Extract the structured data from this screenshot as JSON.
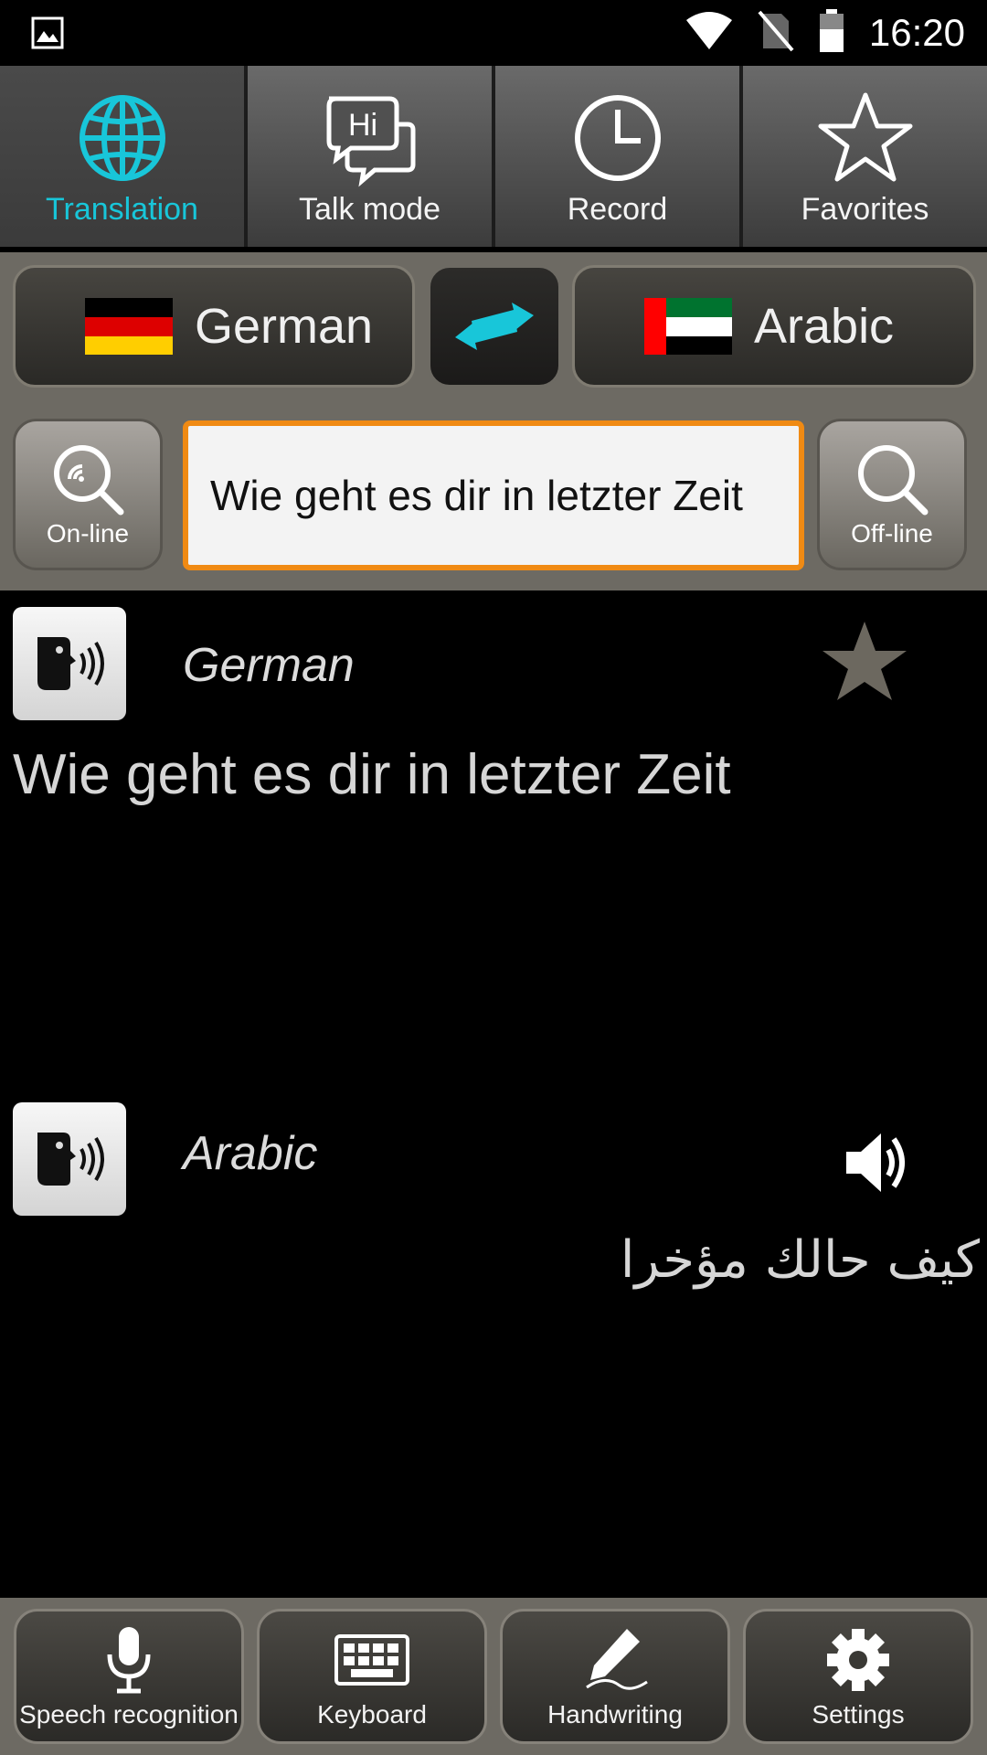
{
  "status": {
    "time": "16:20",
    "icons": [
      "image-icon",
      "wifi-icon",
      "no-sim-icon",
      "battery-icon"
    ]
  },
  "tabs": [
    {
      "label": "Translation",
      "icon": "globe-icon",
      "active": true
    },
    {
      "label": "Talk mode",
      "icon": "chat-bubbles-icon",
      "active": false
    },
    {
      "label": "Record",
      "icon": "clock-icon",
      "active": false
    },
    {
      "label": "Favorites",
      "icon": "star-outline-icon",
      "active": false
    }
  ],
  "languages": {
    "source": {
      "name": "German",
      "flag": "germany-flag-icon"
    },
    "target": {
      "name": "Arabic",
      "flag": "uae-flag-icon"
    },
    "swap_icon": "swap-arrows-icon"
  },
  "search": {
    "online_label": "On-line",
    "offline_label": "Off-line",
    "input_value": "Wie geht es dir in letzter Zeit"
  },
  "result": {
    "source_lang": "German",
    "source_text": "Wie geht es dir in letzter Zeit",
    "target_lang": "Arabic",
    "target_text": "كيف حالك مؤخرا"
  },
  "bottom": [
    {
      "label": "Speech recognition",
      "icon": "microphone-icon"
    },
    {
      "label": "Keyboard",
      "icon": "keyboard-icon"
    },
    {
      "label": "Handwriting",
      "icon": "pen-icon"
    },
    {
      "label": "Settings",
      "icon": "gear-icon"
    }
  ],
  "colors": {
    "accent": "#18c6d9",
    "input_border": "#f08a13",
    "panel": "#6d6a63"
  }
}
